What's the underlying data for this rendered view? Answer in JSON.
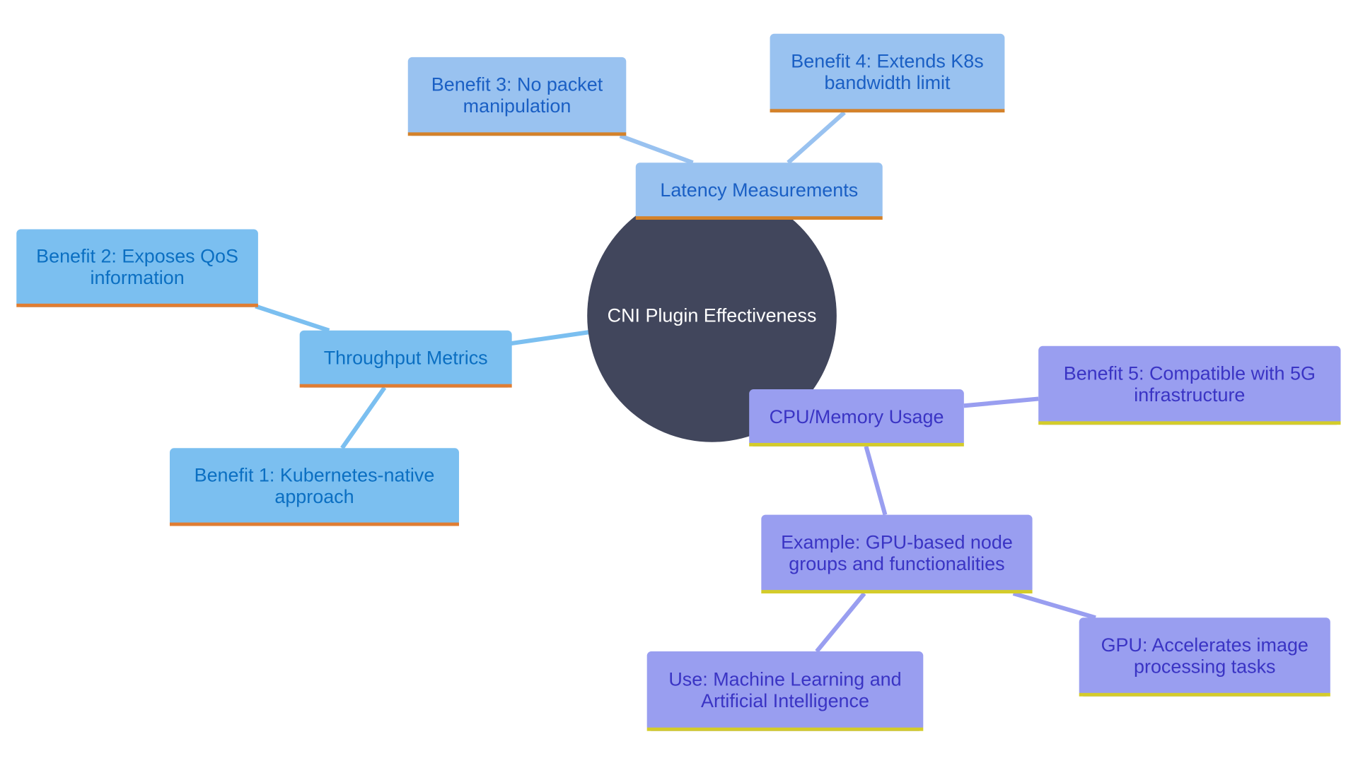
{
  "diagram": {
    "type": "mindmap",
    "root": {
      "id": "root",
      "label": "CNI Plugin Effectiveness"
    },
    "colors": {
      "root_fill": "#41465c",
      "root_text": "#ffffff",
      "branch_throughput_fill": "#7bbff0",
      "branch_throughput_text": "#0b6fc2",
      "branch_throughput_underline": "#e07d32",
      "branch_latency_fill": "#99c2f0",
      "branch_latency_text": "#1a5fc4",
      "branch_latency_underline": "#d4822a",
      "branch_cpu_fill": "#999ef0",
      "branch_cpu_text": "#3a34c4",
      "branch_cpu_underline": "#d4cc2a",
      "edge_throughput": "#7bbff0",
      "edge_latency": "#99c2f0",
      "edge_cpu": "#999ef0"
    },
    "nodes": [
      {
        "id": "throughput",
        "lines": [
          "Throughput Metrics"
        ],
        "branch": "throughput"
      },
      {
        "id": "b1",
        "lines": [
          "Benefit 1: Kubernetes-native",
          "approach"
        ],
        "branch": "throughput"
      },
      {
        "id": "b2",
        "lines": [
          "Benefit 2: Exposes QoS",
          "information"
        ],
        "branch": "throughput"
      },
      {
        "id": "latency",
        "lines": [
          "Latency Measurements"
        ],
        "branch": "latency"
      },
      {
        "id": "b3",
        "lines": [
          "Benefit 3: No packet",
          "manipulation"
        ],
        "branch": "latency"
      },
      {
        "id": "b4",
        "lines": [
          "Benefit 4: Extends K8s",
          "bandwidth limit"
        ],
        "branch": "latency"
      },
      {
        "id": "cpu",
        "lines": [
          "CPU/Memory Usage"
        ],
        "branch": "cpu"
      },
      {
        "id": "b5",
        "lines": [
          "Benefit 5: Compatible with 5G",
          "infrastructure"
        ],
        "branch": "cpu"
      },
      {
        "id": "example",
        "lines": [
          "Example: GPU-based node",
          "groups and functionalities"
        ],
        "branch": "cpu"
      },
      {
        "id": "use",
        "lines": [
          "Use: Machine Learning and",
          "Artificial Intelligence"
        ],
        "branch": "cpu"
      },
      {
        "id": "gpu",
        "lines": [
          "GPU: Accelerates image",
          "processing tasks"
        ],
        "branch": "cpu"
      }
    ],
    "edges": [
      {
        "from": "root",
        "to": "throughput"
      },
      {
        "from": "throughput",
        "to": "b1"
      },
      {
        "from": "throughput",
        "to": "b2"
      },
      {
        "from": "root",
        "to": "latency"
      },
      {
        "from": "latency",
        "to": "b3"
      },
      {
        "from": "latency",
        "to": "b4"
      },
      {
        "from": "root",
        "to": "cpu"
      },
      {
        "from": "cpu",
        "to": "b5"
      },
      {
        "from": "cpu",
        "to": "example"
      },
      {
        "from": "example",
        "to": "use"
      },
      {
        "from": "example",
        "to": "gpu"
      }
    ]
  }
}
